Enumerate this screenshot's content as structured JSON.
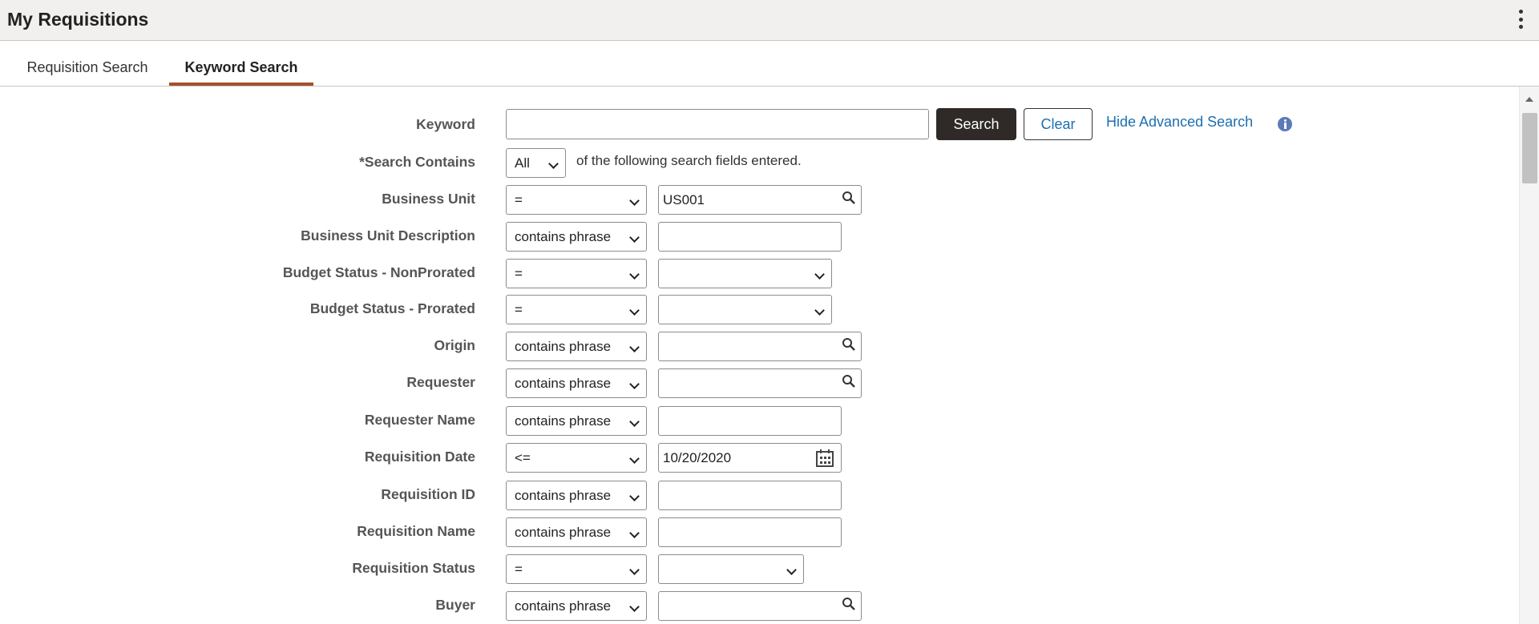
{
  "header": {
    "title": "My Requisitions"
  },
  "tabs": [
    {
      "label": "Requisition Search"
    },
    {
      "label": "Keyword Search"
    }
  ],
  "keyword": {
    "label": "Keyword",
    "value": "",
    "search_button": "Search",
    "clear_button": "Clear",
    "hide_advanced_link": "Hide Advanced Search"
  },
  "search_contains": {
    "label": "*Search Contains",
    "value": "All",
    "trailing_text": "of the following search fields entered."
  },
  "fields": [
    {
      "label": "Business Unit",
      "operator": "=",
      "value": "US001",
      "kind": "lookup"
    },
    {
      "label": "Business Unit Description",
      "operator": "contains phrase",
      "value": "",
      "kind": "text"
    },
    {
      "label": "Budget Status - NonProrated",
      "operator": "=",
      "value": "",
      "kind": "select"
    },
    {
      "label": "Budget Status - Prorated",
      "operator": "=",
      "value": "",
      "kind": "select"
    },
    {
      "label": "Origin",
      "operator": "contains phrase",
      "value": "",
      "kind": "lookup"
    },
    {
      "label": "Requester",
      "operator": "contains phrase",
      "value": "",
      "kind": "lookup"
    },
    {
      "label": "Requester Name",
      "operator": "contains phrase",
      "value": "",
      "kind": "text"
    },
    {
      "label": "Requisition Date",
      "operator": "<=",
      "value": "10/20/2020",
      "kind": "date"
    },
    {
      "label": "Requisition ID",
      "operator": "contains phrase",
      "value": "",
      "kind": "text"
    },
    {
      "label": "Requisition Name",
      "operator": "contains phrase",
      "value": "",
      "kind": "text"
    },
    {
      "label": "Requisition Status",
      "operator": "=",
      "value": "",
      "kind": "select-short"
    },
    {
      "label": "Buyer",
      "operator": "contains phrase",
      "value": "",
      "kind": "lookup"
    }
  ],
  "colors": {
    "accent": "#a0522d",
    "link": "#1b6fb0",
    "primary_button": "#2f2a27",
    "info": "#5c7ab8"
  },
  "icons": [
    "kebab-menu-icon",
    "search-icon",
    "calendar-icon",
    "info-icon",
    "chevron-down-icon"
  ]
}
